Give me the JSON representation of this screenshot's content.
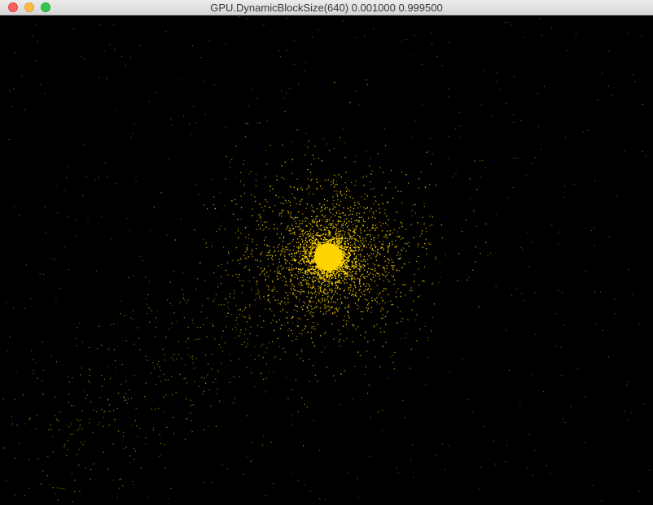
{
  "window": {
    "title": "GPU.DynamicBlockSize(640) 0.001000 0.999500"
  },
  "controls": {
    "close": "close-button",
    "minimize": "minimize-button",
    "zoom": "zoom-button"
  },
  "colors": {
    "particle": "#ffd400",
    "particle_faint": "#e6c000",
    "background": "#000000"
  }
}
